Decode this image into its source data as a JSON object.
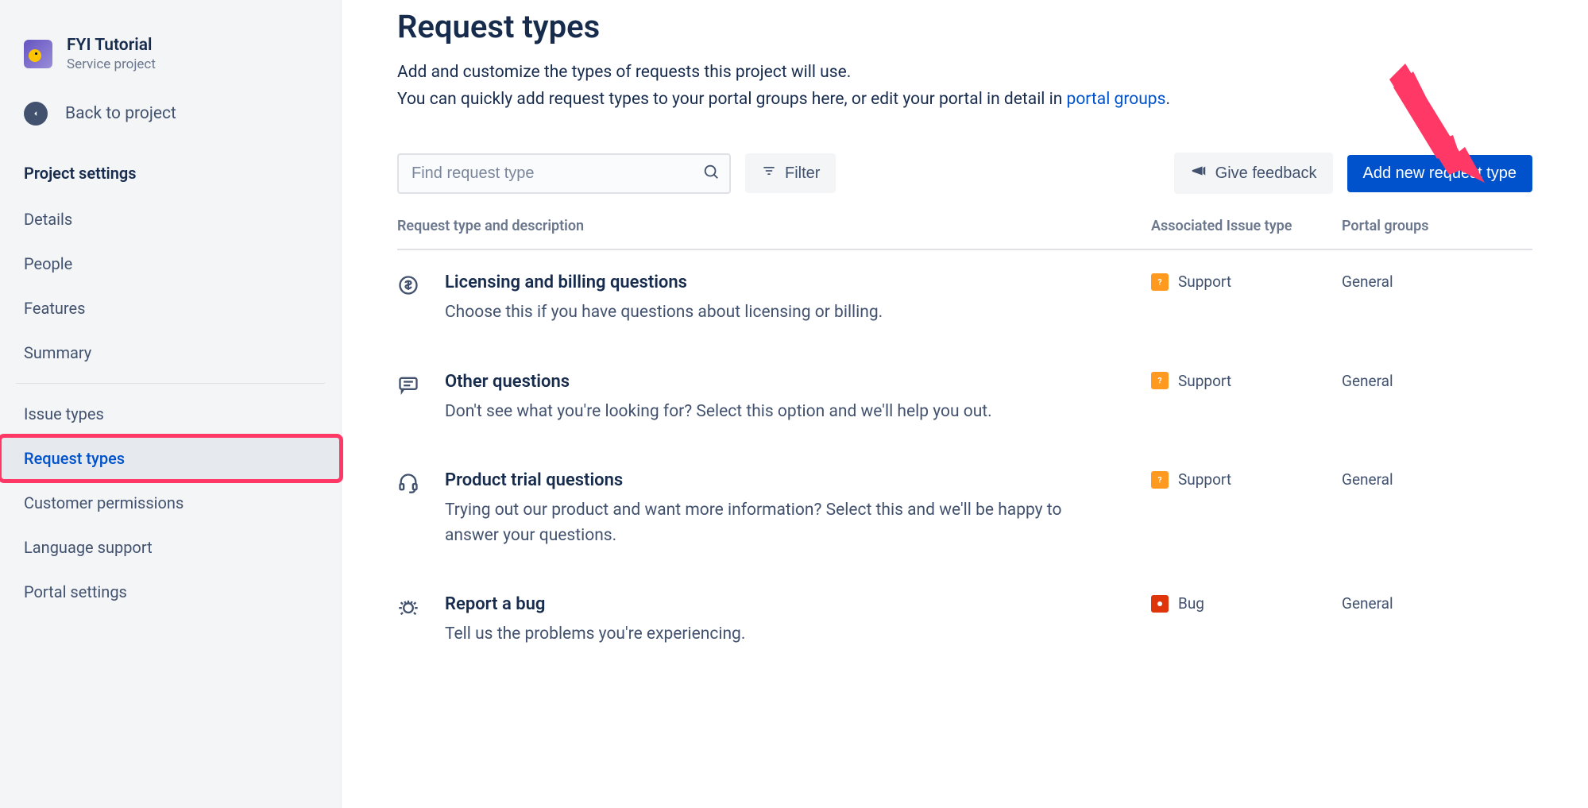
{
  "sidebar": {
    "project_name": "FYI Tutorial",
    "project_subtitle": "Service project",
    "back_label": "Back to project",
    "section_heading": "Project settings",
    "items_top": [
      "Details",
      "People",
      "Features",
      "Summary"
    ],
    "items_bottom": [
      "Issue types",
      "Request types",
      "Customer permissions",
      "Language support",
      "Portal settings"
    ],
    "selected_index": 1
  },
  "header": {
    "title": "Request types",
    "desc_line1": "Add and customize the types of requests this project will use.",
    "desc_line2_pre": "You can quickly add request types to your portal groups here, or edit your portal in detail in ",
    "desc_link": "portal groups",
    "desc_line2_post": "."
  },
  "toolbar": {
    "search_placeholder": "Find request type",
    "filter_label": "Filter",
    "feedback_label": "Give feedback",
    "add_label": "Add new request type"
  },
  "table": {
    "col_request": "Request type and description",
    "col_issue": "Associated Issue type",
    "col_portal": "Portal groups",
    "rows": [
      {
        "icon": "dollar",
        "title": "Licensing and billing questions",
        "desc": "Choose this if you have questions about licensing or billing.",
        "issue_type": "Support",
        "issue_badge": "support",
        "portal_group": "General"
      },
      {
        "icon": "chat",
        "title": "Other questions",
        "desc": "Don't see what you're looking for? Select this option and we'll help you out.",
        "issue_type": "Support",
        "issue_badge": "support",
        "portal_group": "General"
      },
      {
        "icon": "headset",
        "title": "Product trial questions",
        "desc": "Trying out our product and want more information? Select this and we'll be happy to answer your questions.",
        "issue_type": "Support",
        "issue_badge": "support",
        "portal_group": "General"
      },
      {
        "icon": "bug",
        "title": "Report a bug",
        "desc": "Tell us the problems you're experiencing.",
        "issue_type": "Bug",
        "issue_badge": "bug",
        "portal_group": "General"
      }
    ]
  }
}
